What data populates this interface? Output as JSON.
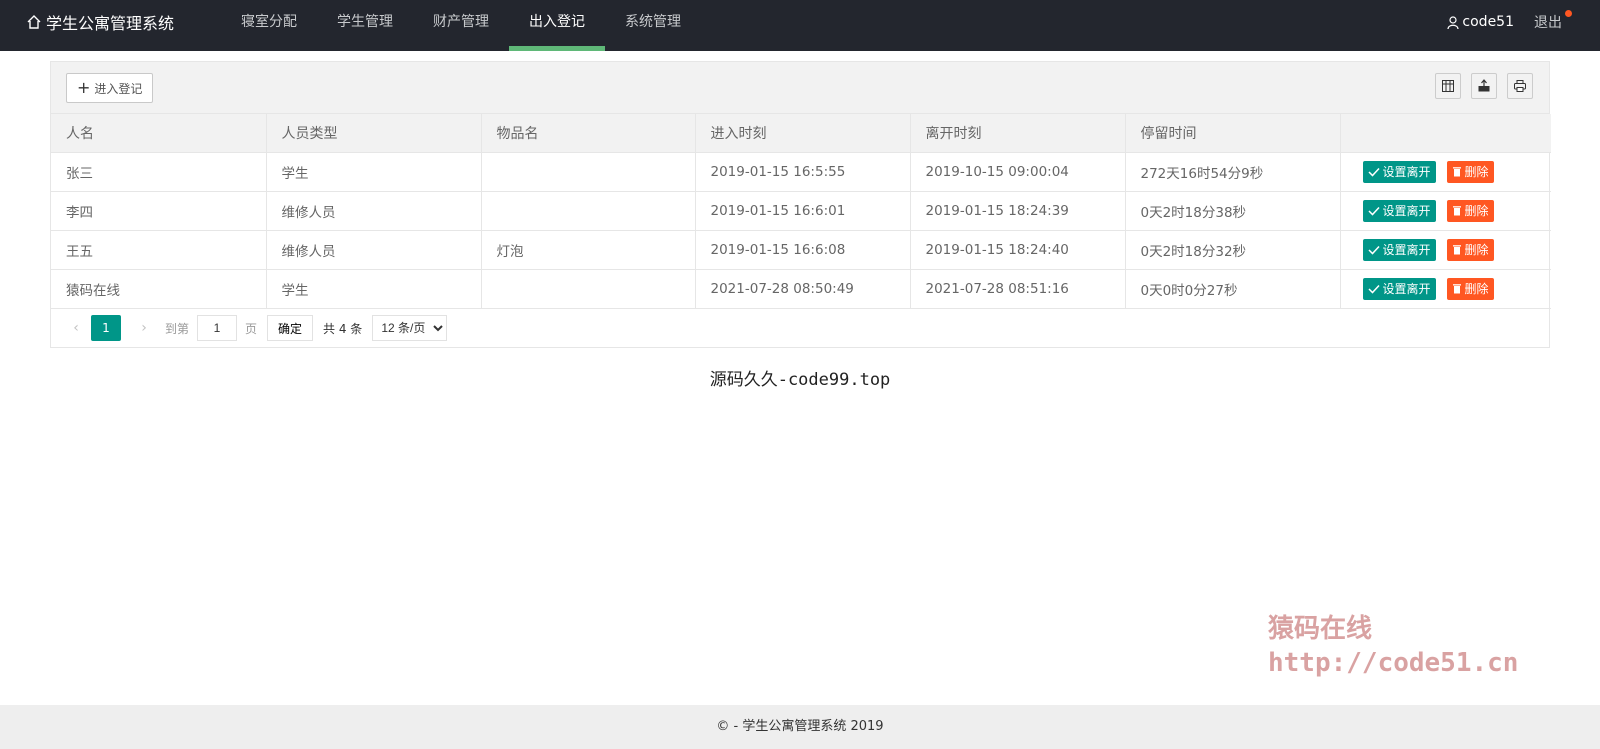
{
  "header": {
    "title": "学生公寓管理系统",
    "nav": [
      "寝室分配",
      "学生管理",
      "财产管理",
      "出入登记",
      "系统管理"
    ],
    "active_nav": "出入登记",
    "user": "code51",
    "logout": "退出"
  },
  "toolbar": {
    "add_label": "进入登记",
    "icons": [
      "columns-icon",
      "export-icon",
      "print-icon"
    ]
  },
  "table": {
    "columns": [
      "人名",
      "人员类型",
      "物品名",
      "进入时刻",
      "离开时刻",
      "停留时间",
      ""
    ],
    "rows": [
      {
        "name": "张三",
        "type": "学生",
        "item": "",
        "enter": "2019-01-15 16:5:55",
        "leave": "2019-10-15 09:00:04",
        "stay": "272天16时54分9秒"
      },
      {
        "name": "李四",
        "type": "维修人员",
        "item": "",
        "enter": "2019-01-15 16:6:01",
        "leave": "2019-01-15 18:24:39",
        "stay": "0天2时18分38秒"
      },
      {
        "name": "王五",
        "type": "维修人员",
        "item": "灯泡",
        "enter": "2019-01-15 16:6:08",
        "leave": "2019-01-15 18:24:40",
        "stay": "0天2时18分32秒"
      },
      {
        "name": "猿码在线",
        "type": "学生",
        "item": "",
        "enter": "2021-07-28 08:50:49",
        "leave": "2021-07-28 08:51:16",
        "stay": "0天0时0分27秒"
      }
    ],
    "row_actions": {
      "leave": "设置离开",
      "delete": "删除"
    }
  },
  "pager": {
    "current": "1",
    "goto_label": "到第",
    "page_input": "1",
    "page_unit": "页",
    "confirm": "确定",
    "total": "共 4 条",
    "per_page": "12 条/页",
    "per_page_options": [
      "12 条/页"
    ]
  },
  "caption": "源码久久-code99.top",
  "watermark": {
    "line1": "猿码在线",
    "line2": "http://code51.cn"
  },
  "footer": "© - 学生公寓管理系统 2019",
  "colors": {
    "header_bg": "#23262e",
    "active_bar": "#5fb878",
    "primary": "#009688",
    "danger": "#ff5722"
  }
}
